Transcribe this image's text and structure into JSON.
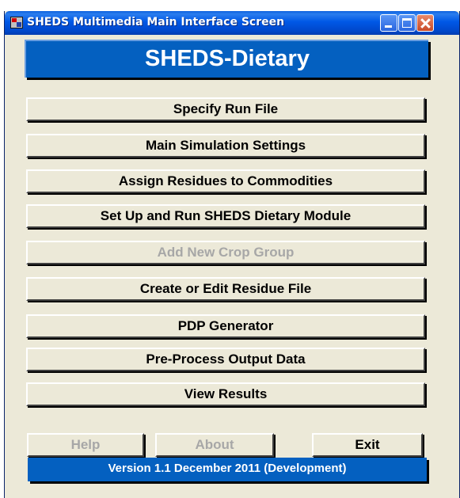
{
  "window": {
    "title": "SHEDS Multimedia Main Interface Screen",
    "icon": "app-icon"
  },
  "banner": {
    "title": "SHEDS-Dietary"
  },
  "menu": {
    "items": [
      {
        "label": "Specify Run File",
        "enabled": true
      },
      {
        "label": "Main Simulation Settings",
        "enabled": true
      },
      {
        "label": "Assign Residues to Commodities",
        "enabled": true
      },
      {
        "label": "Set Up and Run SHEDS Dietary Module",
        "enabled": true
      },
      {
        "label": "Add New Crop Group",
        "enabled": false
      },
      {
        "label": "Create or Edit Residue File",
        "enabled": true
      },
      {
        "label": "PDP Generator",
        "enabled": true
      },
      {
        "label": "Pre-Process Output Data",
        "enabled": true
      },
      {
        "label": "View Results",
        "enabled": true
      }
    ]
  },
  "footer": {
    "help_label": "Help",
    "about_label": "About",
    "exit_label": "Exit",
    "version": "Version 1.1 December 2011 (Development)"
  },
  "colors": {
    "banner": "#0460c0",
    "face": "#ece9d8",
    "disabled_text": "#a7a7a7"
  }
}
